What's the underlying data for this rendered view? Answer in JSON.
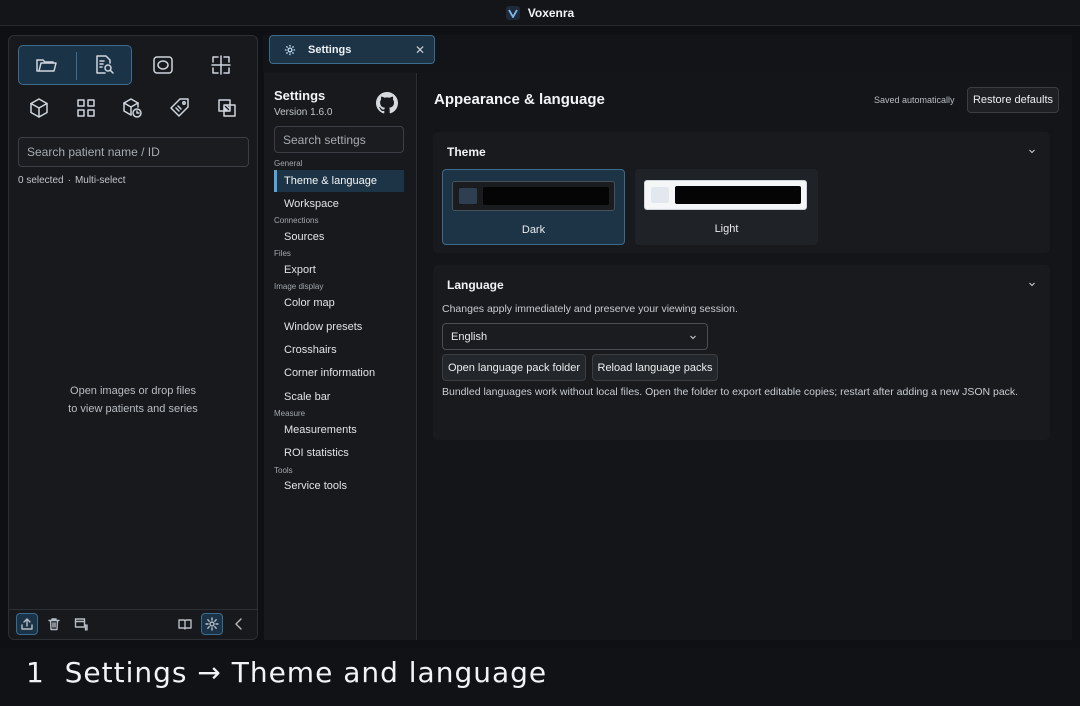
{
  "window": {
    "title": "Voxenra"
  },
  "left_panel": {
    "search_placeholder": "Search patient name / ID",
    "selected_count": "0 selected",
    "separator": "·",
    "multi_select": "Multi-select",
    "empty_line1": "Open images or drop files",
    "empty_line2": "to view patients and series"
  },
  "tab": {
    "label": "Settings"
  },
  "settings_nav": {
    "title": "Settings",
    "version": "Version 1.6.0",
    "search_placeholder": "Search settings",
    "groups": {
      "general": "General",
      "connections": "Connections",
      "files": "Files",
      "image_display": "Image display",
      "measure": "Measure",
      "tools": "Tools"
    },
    "items": {
      "theme_language": "Theme & language",
      "workspace": "Workspace",
      "sources": "Sources",
      "export": "Export",
      "color_map": "Color map",
      "window_presets": "Window presets",
      "crosshairs": "Crosshairs",
      "corner_information": "Corner information",
      "scale_bar": "Scale bar",
      "measurements": "Measurements",
      "roi_statistics": "ROI statistics",
      "service_tools": "Service tools"
    },
    "active_item": "Theme & language"
  },
  "content": {
    "title": "Appearance & language",
    "saved_status": "Saved automatically",
    "restore_label": "Restore defaults",
    "theme": {
      "section_title": "Theme",
      "options": [
        "Dark",
        "Light"
      ],
      "selected": "Dark"
    },
    "language": {
      "section_title": "Language",
      "description": "Changes apply immediately and preserve your viewing session.",
      "selected_language": "English",
      "open_pack_label": "Open language pack folder",
      "reload_packs_label": "Reload language packs",
      "note": "Bundled languages work without local files. Open the folder to export editable copies; restart after adding a new JSON pack."
    }
  },
  "caption": {
    "text": "1  Settings → Theme and language"
  },
  "colors": {
    "accent": "#5ba3dd",
    "active_bg": "#1d3446",
    "panel_bg": "#17191c"
  }
}
